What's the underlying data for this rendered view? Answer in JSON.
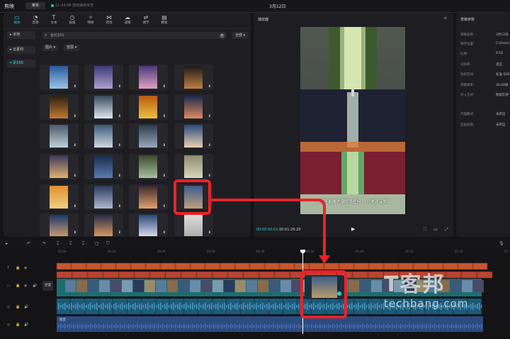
{
  "app": {
    "name": "剪映",
    "menu_label": "菜单",
    "autosave": "11:34:08 自动保存本地",
    "project_title": "3月12日"
  },
  "toolbar": {
    "tabs": [
      {
        "label": "媒体",
        "icon": "media-icon"
      },
      {
        "label": "音频",
        "icon": "audio-icon"
      },
      {
        "label": "文本",
        "icon": "text-icon"
      },
      {
        "label": "贴纸",
        "icon": "sticker-icon"
      },
      {
        "label": "特效",
        "icon": "effects-icon"
      },
      {
        "label": "转场",
        "icon": "transition-icon"
      },
      {
        "label": "滤镜",
        "icon": "filter-icon"
      },
      {
        "label": "调节",
        "icon": "adjust-icon"
      },
      {
        "label": "模板",
        "icon": "template-icon"
      }
    ]
  },
  "sidebar": {
    "items": [
      {
        "label": "本地"
      },
      {
        "label": "云素材"
      },
      {
        "label": "素材库"
      }
    ]
  },
  "search": {
    "value": "台北101",
    "clear_icon": "×",
    "filter_label": "全部"
  },
  "filters": {
    "type": "图片",
    "sort": "竖屏"
  },
  "library": {
    "download_icon": "⬇"
  },
  "player": {
    "title": "播放器",
    "menu_icon": "≡",
    "subtitle": "我们不能描述 就代表任何 ... 只是还沒发现",
    "time_current": "00:00:50:01",
    "time_total": "00:01:26:20"
  },
  "props": {
    "title": "草稿参数",
    "rows": [
      {
        "k": "草稿名称:",
        "v": "3月12日"
      },
      {
        "k": "保存位置:",
        "v": "C:/Users..."
      },
      {
        "k": "比例:",
        "v": "9:16"
      },
      {
        "k": "分辨率:",
        "v": "适应"
      },
      {
        "k": "色彩空间:",
        "v": "标准 SDR"
      },
      {
        "k": "草稿帧率:",
        "v": "30.00帧"
      },
      {
        "k": "导入方式:",
        "v": "保留在原"
      },
      {
        "k": "代理模式:",
        "v": "未开启"
      },
      {
        "k": "自由层级:",
        "v": "未开启"
      }
    ]
  },
  "timeline": {
    "ticks": [
      "00:00",
      "00:10",
      "00:20",
      "00:30",
      "00:40",
      "00:50",
      "01:00",
      "01:10",
      "01:20",
      "01:30"
    ],
    "cover_label": "封面",
    "audio_label": "轻音"
  },
  "watermark": {
    "cn": "T客邦",
    "en": "techbang.com"
  },
  "colors": {
    "accent": "#2ccfd0",
    "highlight": "#e8232a",
    "text_track": "#c4572f",
    "video_track": "#1b6e6e",
    "audio_track": "#2b4c80"
  }
}
